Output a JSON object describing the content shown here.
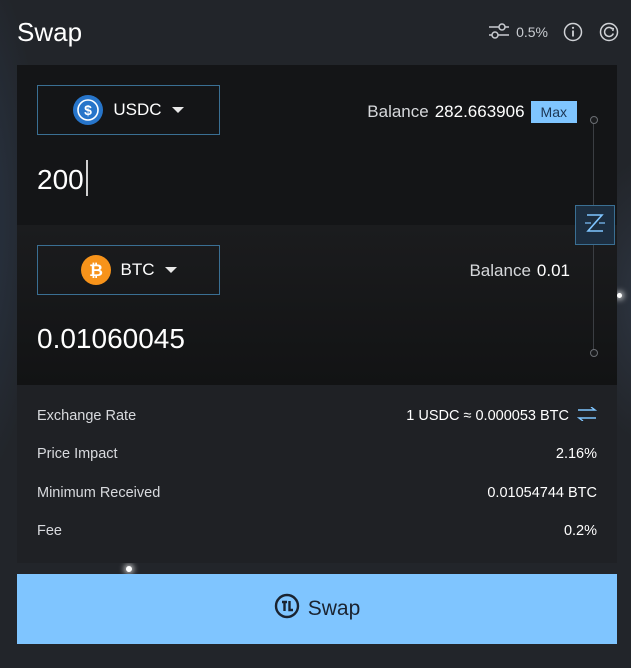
{
  "header": {
    "title": "Swap",
    "slippage": "0.5%"
  },
  "from": {
    "token": "USDC",
    "balance_label": "Balance",
    "balance_value": "282.663906",
    "max_label": "Max",
    "amount": "200"
  },
  "to": {
    "token": "BTC",
    "balance_label": "Balance",
    "balance_value": "0.01",
    "amount": "0.01060045"
  },
  "details": [
    {
      "label": "Exchange Rate",
      "value": "1 USDC ≈ 0.000053 BTC"
    },
    {
      "label": "Price Impact",
      "value": "2.16%"
    },
    {
      "label": "Minimum Received",
      "value": "0.01054744 BTC"
    },
    {
      "label": "Fee",
      "value": "0.2%"
    }
  ],
  "swap_button": {
    "label": "Swap"
  },
  "colors": {
    "accent": "#7fc5ff",
    "usdc": "#2775ca",
    "btc": "#f7931a",
    "border": "#3a6f93"
  }
}
